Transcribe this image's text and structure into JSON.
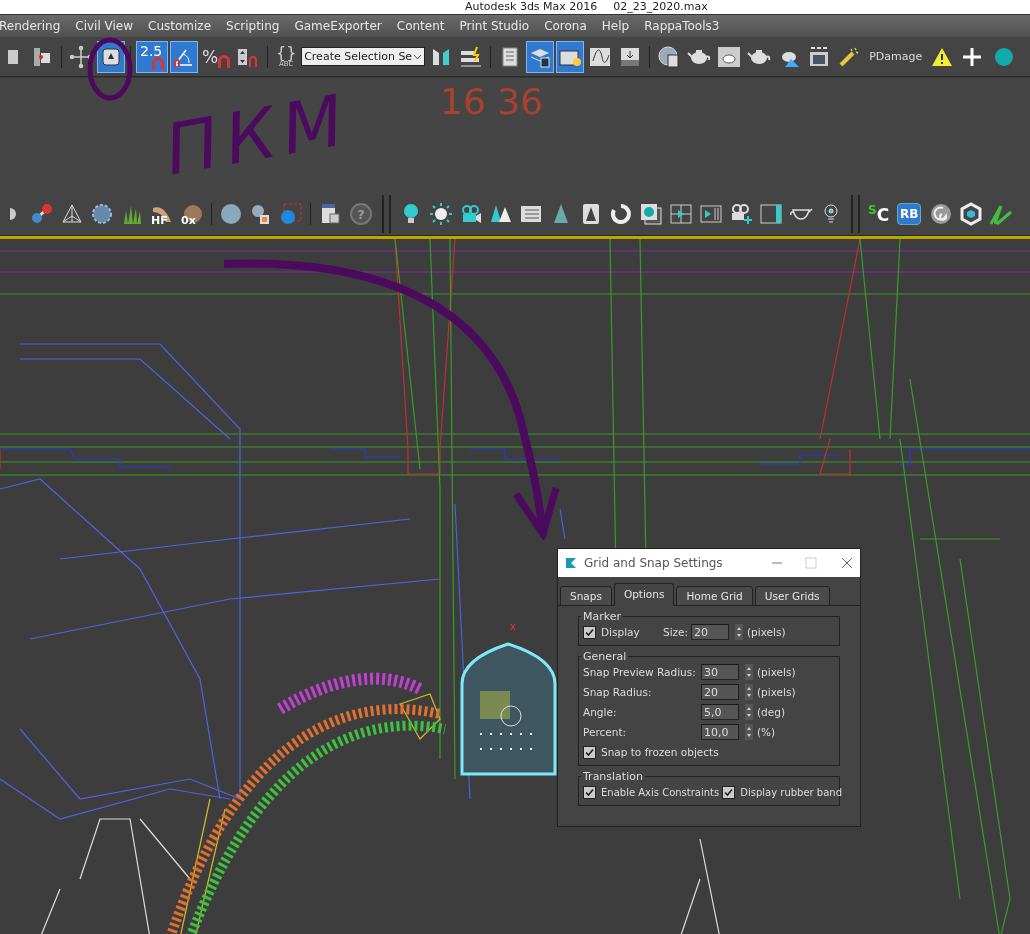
{
  "title_bar": {
    "app": "Autodesk 3ds Max 2016",
    "file": "02_23_2020.max"
  },
  "menu": [
    "Rendering",
    "Civil View",
    "Customize",
    "Scripting",
    "GameExporter",
    "Content",
    "Print Studio",
    "Corona",
    "Help",
    "RappaTools3"
  ],
  "main_toolbar": [
    {
      "kind": "button",
      "selected": false
    },
    {
      "kind": "button",
      "selected": false
    },
    {
      "kind": "separator"
    },
    {
      "kind": "button",
      "selected": false
    },
    {
      "kind": "button",
      "selected": true
    },
    {
      "kind": "separator"
    },
    {
      "kind": "snap",
      "label": "2.5",
      "selected": true
    },
    {
      "kind": "button",
      "selected": true
    },
    {
      "kind": "snap",
      "label": "%",
      "selected": false
    },
    {
      "kind": "button",
      "selected": false
    },
    {
      "kind": "separator"
    },
    {
      "kind": "named",
      "label": "{}",
      "sub": "ABC"
    },
    {
      "kind": "dropdown",
      "value": "Create Selection Se"
    },
    {
      "kind": "button",
      "selected": false
    },
    {
      "kind": "button",
      "selected": false
    },
    {
      "kind": "separator"
    },
    {
      "kind": "button",
      "selected": false
    },
    {
      "kind": "button",
      "selected": true
    },
    {
      "kind": "button",
      "selected": true
    },
    {
      "kind": "button",
      "selected": false
    },
    {
      "kind": "button",
      "selected": false
    },
    {
      "kind": "separator"
    },
    {
      "kind": "button",
      "selected": false
    },
    {
      "kind": "button",
      "selected": false
    },
    {
      "kind": "button",
      "selected": false
    },
    {
      "kind": "button",
      "selected": false
    },
    {
      "kind": "button",
      "selected": false
    },
    {
      "kind": "button",
      "selected": false
    },
    {
      "kind": "button",
      "selected": false
    },
    {
      "kind": "text",
      "label": "PDamage"
    },
    {
      "kind": "button",
      "selected": false
    },
    {
      "kind": "button",
      "selected": false
    },
    {
      "kind": "button",
      "selected": false
    }
  ],
  "second_toolbar": [
    {
      "kind": "button"
    },
    {
      "kind": "button"
    },
    {
      "kind": "button"
    },
    {
      "kind": "button"
    },
    {
      "kind": "button"
    },
    {
      "kind": "overlay",
      "label": "HF"
    },
    {
      "kind": "overlay",
      "label": "0x"
    },
    {
      "kind": "separator"
    },
    {
      "kind": "button"
    },
    {
      "kind": "button"
    },
    {
      "kind": "button"
    },
    {
      "kind": "separator"
    },
    {
      "kind": "button"
    },
    {
      "kind": "circle",
      "label": "?"
    },
    {
      "kind": "double-separator"
    },
    {
      "kind": "button"
    },
    {
      "kind": "button"
    },
    {
      "kind": "button"
    },
    {
      "kind": "button"
    },
    {
      "kind": "button"
    },
    {
      "kind": "button"
    },
    {
      "kind": "button"
    },
    {
      "kind": "button"
    },
    {
      "kind": "button"
    },
    {
      "kind": "button"
    },
    {
      "kind": "button"
    },
    {
      "kind": "button"
    },
    {
      "kind": "button"
    },
    {
      "kind": "button"
    },
    {
      "kind": "button"
    },
    {
      "kind": "double-separator"
    },
    {
      "kind": "script",
      "label": "$^{S}$C"
    },
    {
      "kind": "badge",
      "label": "RB"
    },
    {
      "kind": "button"
    },
    {
      "kind": "button"
    },
    {
      "kind": "button"
    }
  ],
  "viewport": {
    "gizmo_label": "x"
  },
  "dialog": {
    "title": "Grid and Snap Settings",
    "tabs": [
      {
        "label": "Snaps",
        "selected": false
      },
      {
        "label": "Options",
        "selected": true
      },
      {
        "label": "Home Grid",
        "selected": false
      },
      {
        "label": "User Grids",
        "selected": false
      }
    ],
    "groups": [
      {
        "title": "Marker",
        "rows": [
          {
            "kind": "check-spinner",
            "label": "Display",
            "checked": true,
            "field_label": "Size:",
            "value": "20",
            "unit": "(pixels)"
          }
        ]
      },
      {
        "title": "General",
        "rows": [
          {
            "kind": "spinner",
            "label": "Snap Preview Radius:",
            "value": "30",
            "unit": "(pixels)"
          },
          {
            "kind": "spinner",
            "label": "Snap Radius:",
            "value": "20",
            "unit": "(pixels)"
          },
          {
            "kind": "spinner",
            "label": "Angle:",
            "value": "5,0",
            "unit": "(deg)"
          },
          {
            "kind": "spinner",
            "label": "Percent:",
            "value": "10,0",
            "unit": "(%)"
          },
          {
            "kind": "checkbox",
            "label": "Snap to frozen objects",
            "checked": true
          }
        ]
      },
      {
        "title": "Translation",
        "rows": [
          {
            "kind": "checks",
            "items": [
              {
                "label": "Enable Axis Constraints",
                "checked": true
              },
              {
                "label": "Display rubber band",
                "checked": true
              }
            ]
          }
        ]
      }
    ]
  },
  "annotations": [
    {
      "kind": "note",
      "text": "ПКМ",
      "color": "#4b0a5e"
    },
    {
      "kind": "time",
      "text": "16 36",
      "color": "#a8412e"
    }
  ]
}
